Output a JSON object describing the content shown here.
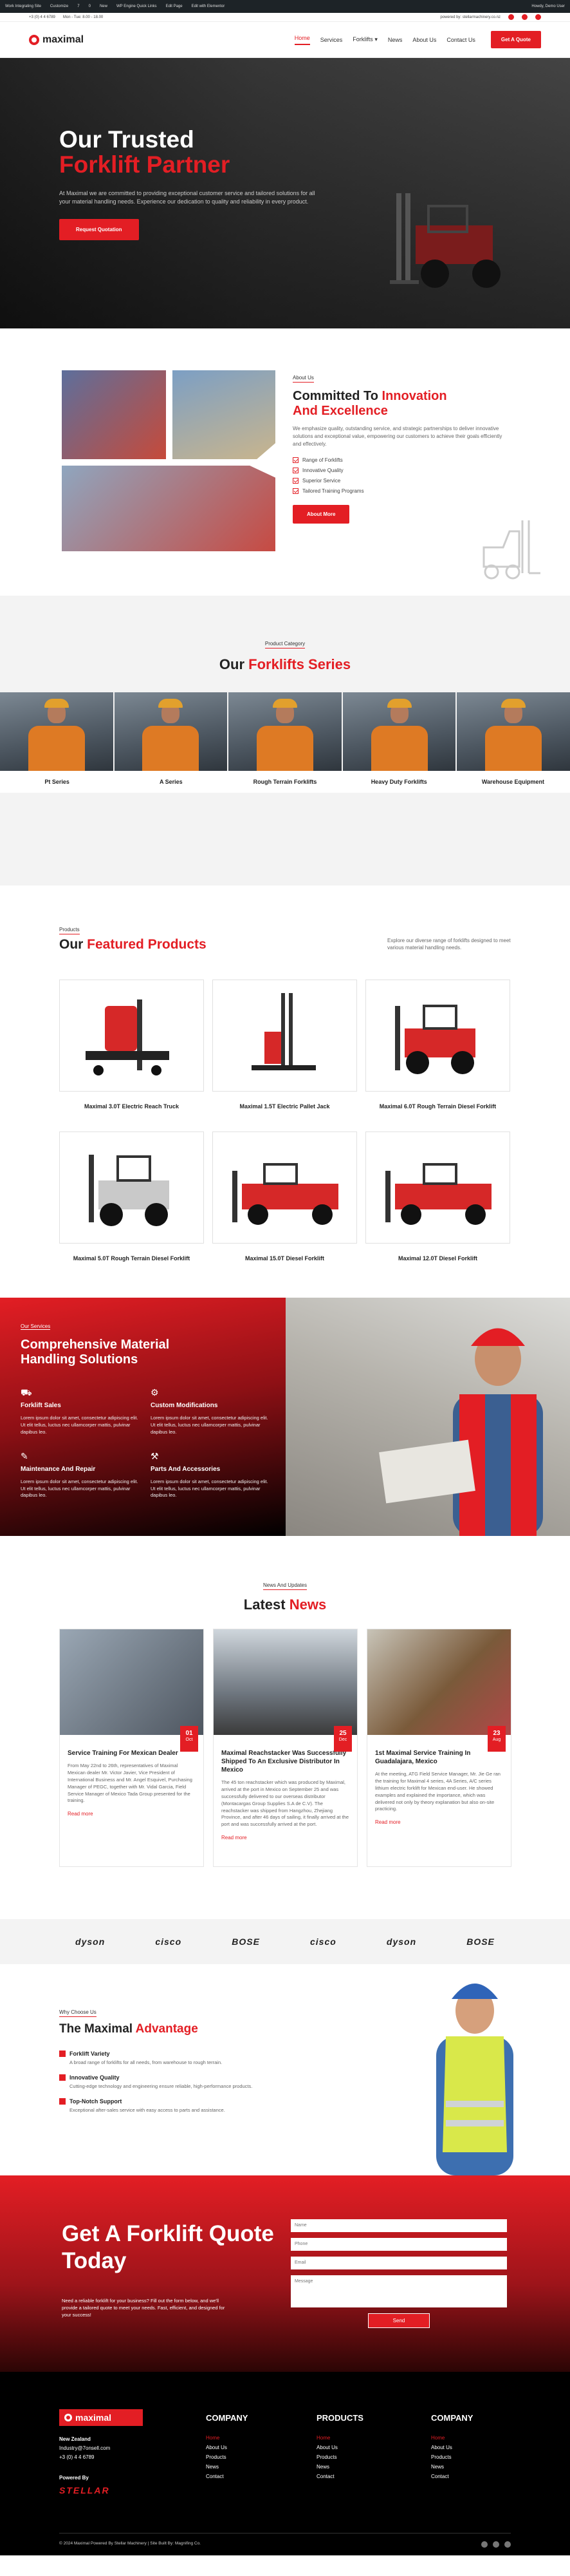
{
  "wp_bar": {
    "items": [
      "Work Integrating Site",
      "Customize",
      "7",
      "0",
      "New",
      "WP Engine Quick Links",
      "Edit Page",
      "Edit with Elementor"
    ],
    "greeting": "Howdy, Demo User"
  },
  "topbar": {
    "phone": "+3 (0) 4 4 6789",
    "hours": "Mon - Tue: 8.00 - 18.00",
    "powered": "powered by: stellarmachinery.co.nz"
  },
  "brand": {
    "name": "maximal"
  },
  "nav": {
    "items": [
      "Home",
      "Services",
      "Forklifts",
      "News",
      "About Us",
      "Contact Us"
    ],
    "cta": "Get A Quote",
    "active_index": 0
  },
  "hero": {
    "title_line1": "Our Trusted",
    "title_line2": "Forklift Partner",
    "body": "At Maximal we are committed to providing exceptional customer service and tailored solutions for all your material handling needs. Experience our dedication to quality and reliability in every product.",
    "cta": "Request Quotation"
  },
  "about": {
    "tag": "About Us",
    "title_black": "Committed To ",
    "title_red_1": "Innovation",
    "title_red_2": "And Excellence",
    "body": "We emphasize quality, outstanding service, and strategic partnerships to deliver innovative solutions and exceptional value, empowering our customers to achieve their goals efficiently and effectively.",
    "checks": [
      "Range of Forklifts",
      "Innovative Quality",
      "Superior Service",
      "Tailored Training Programs"
    ],
    "cta": "About More"
  },
  "series": {
    "tag": "Product Category",
    "title_black": "Our ",
    "title_red": "Forklifts Series",
    "items": [
      "Pt Series",
      "A Series",
      "Rough Terrain Forklifts",
      "Heavy Duty Forklifts",
      "Warehouse Equipment"
    ]
  },
  "products": {
    "tag": "Products",
    "title_black": "Our ",
    "title_red": "Featured Products",
    "desc": "Explore our diverse range of forklifts designed to meet various material handling needs.",
    "items": [
      "Maximal 3.0T Electric Reach Truck",
      "Maximal 1.5T Electric Pallet Jack",
      "Maximal 6.0T Rough Terrain Diesel Forklift",
      "Maximal 5.0T Rough Terrain Diesel Forklift",
      "Maximal 15.0T Diesel Forklift",
      "Maximal 12.0T Diesel Forklift"
    ]
  },
  "services": {
    "tag": "Our Services",
    "title": "Comprehensive Material Handling Solutions",
    "items": [
      {
        "icon": "forklift-icon",
        "title": "Forklift Sales",
        "body": "Lorem ipsum dolor sit amet, consectetur adipiscing elit. Ut elit tellus, luctus nec ullamcorper mattis, pulvinar dapibus leo."
      },
      {
        "icon": "gear-icon",
        "title": "Custom Modifications",
        "body": "Lorem ipsum dolor sit amet, consectetur adipiscing elit. Ut elit tellus, luctus nec ullamcorper mattis, pulvinar dapibus leo."
      },
      {
        "icon": "wrench-icon",
        "title": "Maintenance And Repair",
        "body": "Lorem ipsum dolor sit amet, consectetur adipiscing elit. Ut elit tellus, luctus nec ullamcorper mattis, pulvinar dapibus leo."
      },
      {
        "icon": "parts-icon",
        "title": "Parts And Accessories",
        "body": "Lorem ipsum dolor sit amet, consectetur adipiscing elit. Ut elit tellus, luctus nec ullamcorper mattis, pulvinar dapibus leo."
      }
    ]
  },
  "news": {
    "tag": "News And Updates",
    "title_black": "Latest ",
    "title_red": "News",
    "read_more": "Read more",
    "items": [
      {
        "day": "01",
        "month": "Oct",
        "title": "Service Training For Mexican Dealer",
        "body": "From May 22nd to 26th, representatives of Maximal Mexican dealer Mr. Victor Javier, Vice President of International Business and Mr. Angel Esquivel, Purchasing Manager of PEGC, together with Mr. Vidal Garcia, Field Service Manager of Mexico Tada Group presented for the training."
      },
      {
        "day": "25",
        "month": "Dec",
        "title": "Maximal Reachstacker Was Successfully Shipped To An Exclusive Distributor In Mexico",
        "body": "The 45 ton reachstacker which was produced by Maximal, arrived at the port in Mexico on September 25 and was successfully delivered to our overseas distributor (Montacargas Group Supplies S.A de C.V). The reachstacker was shipped from Hangzhou, Zhejiang Province, and after 46 days of sailing, it finally arrived at the port and was successfully arrived at the port."
      },
      {
        "day": "23",
        "month": "Aug",
        "title": "1st Maximal Service Training In Guadalajara, Mexico",
        "body": "At the meeting, ATG Field Service Manager, Mr. Jie Ge ran the training for Maximal 4 series, 4A Series, A/C series lithium electric forklift for Mexican end-user. He showed examples and explained the importance, which was delivered not only by theory explanation but also on-site practicing."
      }
    ]
  },
  "partners": [
    "dyson",
    "cisco",
    "BOSE",
    "cisco",
    "dyson",
    "BOSE"
  ],
  "advantage": {
    "tag": "Why Choose Us",
    "title_black": "The Maximal ",
    "title_red": "Advantage",
    "items": [
      {
        "title": "Forklift Variety",
        "body": "A broad range of forklifts for all needs, from warehouse to rough terrain."
      },
      {
        "title": "Innovative Quality",
        "body": "Cutting-edge technology and engineering ensure reliable, high-performance products."
      },
      {
        "title": "Top-Notch Support",
        "body": "Exceptional after-sales service with easy access to parts and assistance."
      }
    ]
  },
  "quote": {
    "title": "Get A Forklift Quote Today",
    "body": "Need a reliable forklift for your business? Fill out the form below, and we'll provide a tailored quote to meet your needs. Fast, efficient, and designed for your success!",
    "fields": [
      "Name",
      "Phone",
      "Email",
      "Message"
    ],
    "send": "Send"
  },
  "footer": {
    "location": "New Zealand",
    "email": "Industry@7onsell.com",
    "phone": "+3 (0) 4 4 6789",
    "powered_by": "Powered By",
    "stellar": "STELLAR",
    "cols": [
      {
        "title": "COMPANY",
        "items": [
          "Home",
          "About Us",
          "Products",
          "News",
          "Contact"
        ]
      },
      {
        "title": "PRODUCTS",
        "items": [
          "Home",
          "About Us",
          "Products",
          "News",
          "Contact"
        ]
      },
      {
        "title": "COMPANY",
        "items": [
          "Home",
          "About Us",
          "Products",
          "News",
          "Contact"
        ]
      }
    ],
    "copyright": "© 2024 Maximal Powered By Stellar Machinery | Site Built By: Magnifing Co."
  },
  "colors": {
    "accent": "#e31e24",
    "dark": "#1a1a1a"
  }
}
